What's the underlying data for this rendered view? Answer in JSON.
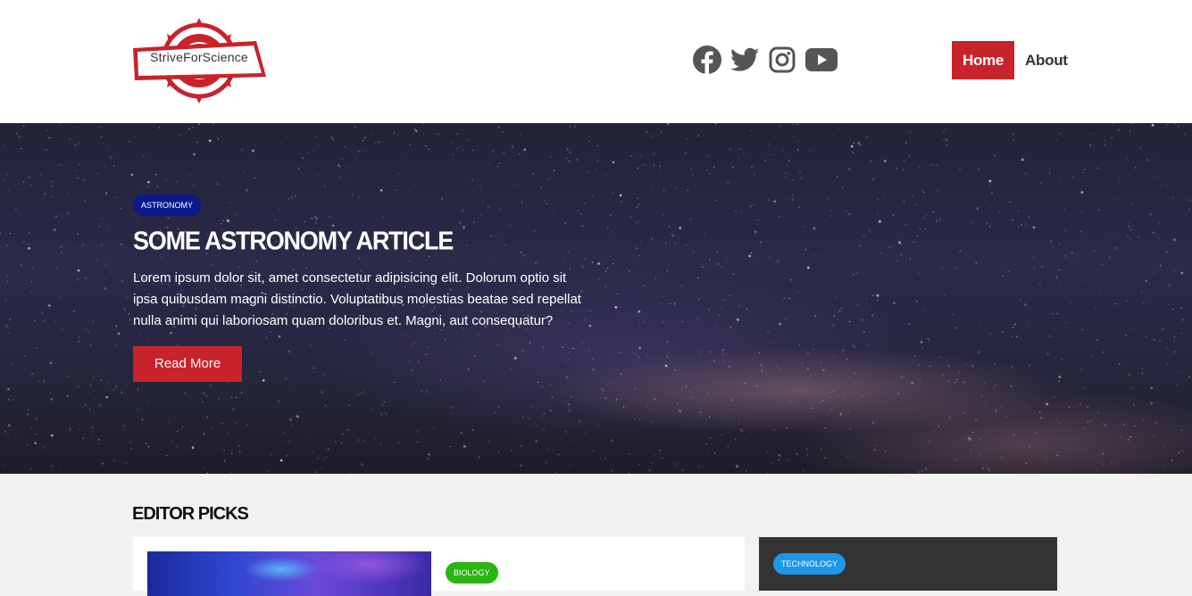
{
  "header": {
    "logo": {
      "text": "StriveForScience",
      "brand_color": "#c8232a"
    },
    "socials": [
      {
        "name": "facebook-icon"
      },
      {
        "name": "twitter-icon"
      },
      {
        "name": "instagram-icon"
      },
      {
        "name": "youtube-icon"
      }
    ],
    "nav": {
      "home_label": "Home",
      "about_label": "About",
      "active": "Home"
    }
  },
  "hero": {
    "category": "ASTRONOMY",
    "title": "SOME ASTRONOMY ARTICLE",
    "text": "Lorem ipsum dolor sit, amet consectetur adipisicing elit. Dolorum optio sit ipsa quibusdam magni distinctio. Voluptatibus molestias beatae sed repellat nulla animi qui laboriosam quam doloribus et. Magni, aut consequatur?",
    "button_label": "Read More"
  },
  "editor_picks": {
    "title": "EDITOR PICKS",
    "cards": [
      {
        "category": "BIOLOGY",
        "category_color": "#2bb512"
      },
      {
        "category": "TECHNOLOGY",
        "category_color": "#1d97e8"
      }
    ]
  },
  "colors": {
    "accent": "#c8232a",
    "astronomy": "#0a1a8c",
    "biology": "#2bb512",
    "technology": "#1d97e8"
  }
}
